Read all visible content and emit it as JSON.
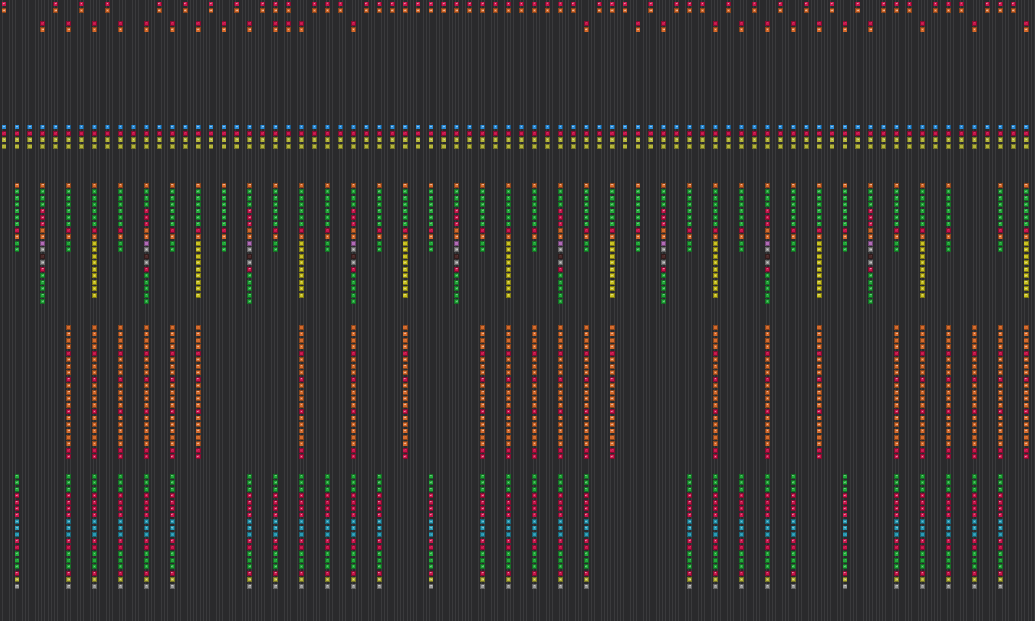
{
  "colors": {
    "background": "#2a2a2c",
    "column_divider": "#3a3a3c",
    "text": "#ffffff",
    "red": "#c8144a",
    "orange": "#d46a2c",
    "blue": "#2a8ad6",
    "olive": "#b4b43a",
    "green": "#22a83a",
    "purple": "#b06ab6",
    "grey": "#9a9a9a",
    "dark": "#4a2a2a",
    "yellow": "#c8c020",
    "cyan": "#2a9ab4"
  },
  "legend": {
    "pf": "red",
    "ob": "orange",
    "po": "blue",
    "lo": "olive",
    "cl": "green",
    "bo": "purple",
    "ro": "grey",
    "ct": "dark",
    "ye": "yellow",
    "cy": "cyan"
  },
  "tracks": {
    "top_row": [
      "pf",
      "ob"
    ],
    "header_block": [
      "po",
      "pf",
      "lo",
      "lo"
    ],
    "block_a": [
      "ob",
      "cl",
      "cl",
      "cl",
      "cl",
      "cl",
      "cl",
      "pf",
      "ob",
      "cl",
      "cl"
    ],
    "block_a_alt": [
      "ob",
      "cl",
      "cl",
      "cl",
      "pf",
      "pf",
      "pf",
      "ob",
      "ob",
      "bo",
      "ro",
      "ct",
      "ro",
      "pf",
      "cl",
      "cl",
      "cl",
      "cl",
      "cl"
    ],
    "block_a_long": [
      "ob",
      "cl",
      "cl",
      "cl",
      "cl",
      "cl",
      "cl",
      "pf",
      "ob",
      "ye",
      "ye",
      "ye",
      "ye",
      "ye",
      "ye",
      "ye",
      "ye",
      "ye"
    ],
    "block_b": [
      "ob",
      "ob",
      "ob",
      "ob",
      "pf",
      "ob",
      "ob",
      "ob",
      "pf",
      "ob",
      "ob",
      "ob",
      "ob",
      "pf",
      "ob",
      "ob",
      "ob",
      "ob",
      "ob",
      "pf",
      "pf"
    ],
    "block_c": [
      "cl",
      "cl",
      "cl",
      "pf",
      "pf",
      "pf",
      "pf",
      "cy",
      "cy",
      "cy",
      "pf",
      "pf",
      "cl",
      "cl",
      "cl",
      "pf",
      "lo",
      "ro"
    ]
  },
  "rows": {
    "top_a": [
      0,
      4,
      6,
      8,
      12,
      14,
      16,
      18,
      20,
      21,
      22,
      24,
      25,
      26,
      28,
      29,
      30,
      31,
      32,
      33,
      34,
      35,
      36,
      37,
      38,
      39,
      40,
      41,
      42,
      43,
      44,
      46,
      47,
      48,
      50,
      52,
      53,
      54,
      56,
      58,
      60,
      62,
      64,
      66,
      68,
      69,
      70,
      72,
      73,
      74,
      76,
      77,
      78
    ],
    "top_b": [
      3,
      5,
      7,
      9,
      11,
      13,
      15,
      17,
      19,
      21,
      22,
      23,
      27,
      45,
      49,
      51,
      55,
      57,
      59,
      61,
      63,
      65,
      67,
      71,
      75,
      79
    ],
    "header": [
      0,
      1,
      2,
      3,
      4,
      5,
      6,
      7,
      8,
      9,
      10,
      11,
      12,
      13,
      14,
      15,
      16,
      17,
      18,
      19,
      20,
      21,
      22,
      23,
      24,
      25,
      26,
      27,
      28,
      29,
      30,
      31,
      32,
      33,
      34,
      35,
      36,
      37,
      38,
      39,
      40,
      41,
      42,
      43,
      44,
      45,
      46,
      47,
      48,
      49,
      50,
      51,
      52,
      53,
      54,
      55,
      56,
      57,
      58,
      59,
      60,
      61,
      62,
      63,
      64,
      65,
      66,
      67,
      68,
      69,
      70,
      71,
      72,
      73,
      74,
      75,
      76,
      77,
      78,
      79
    ],
    "block_a": [
      1,
      5,
      9,
      13,
      17,
      21,
      25,
      29,
      33,
      37,
      41,
      45,
      49,
      53,
      57,
      61,
      65,
      69,
      73,
      77
    ],
    "block_a_alt": [
      3,
      11,
      19,
      27,
      35,
      43,
      51,
      59,
      67
    ],
    "block_a_long": [
      7,
      15,
      23,
      31,
      39,
      47,
      55,
      63,
      71,
      79
    ],
    "block_b": [
      5,
      7,
      9,
      11,
      13,
      15,
      23,
      27,
      31,
      37,
      39,
      41,
      43,
      45,
      47,
      55,
      59,
      63,
      69,
      71,
      73,
      75,
      77,
      79
    ],
    "block_c": [
      1,
      5,
      7,
      9,
      11,
      13,
      19,
      21,
      23,
      25,
      27,
      29,
      33,
      37,
      39,
      41,
      43,
      45,
      53,
      55,
      57,
      59,
      61,
      65,
      69,
      71,
      73,
      75,
      77
    ]
  }
}
